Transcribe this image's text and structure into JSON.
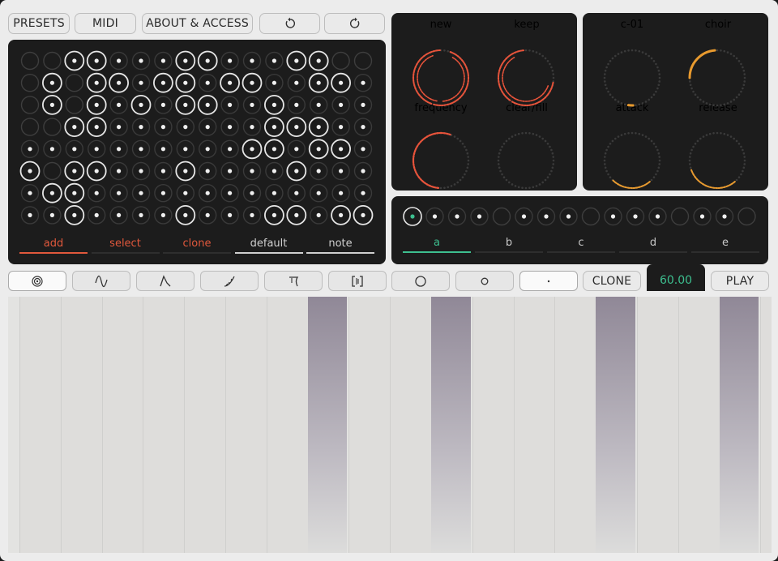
{
  "toolbar": {
    "presets_label": "PRESETS",
    "midi_label": "MIDI",
    "about_label": "ABOUT & ACCESS",
    "undo_icon": "undo-icon",
    "redo_icon": "redo-icon"
  },
  "grid": {
    "rows": [
      "--BB...BB...BB--",
      "-B-BB.BB.BB..BB.",
      "-B-B.B.BB..B....",
      "--BB.......BBB..",
      "..........BB.BB.",
      "B-BB...B....B...",
      ".BB.............",
      "..B....B...BB.BB"
    ],
    "tabs": [
      {
        "label": "add",
        "color": "#e0583c"
      },
      {
        "label": "select",
        "color": "#e0583c"
      },
      {
        "label": "clone",
        "color": "#e0583c"
      },
      {
        "label": "default",
        "color": "#cfcfcf"
      },
      {
        "label": "note",
        "color": "#cfcfcf"
      }
    ]
  },
  "knobs": {
    "new": {
      "label": "new",
      "color": "#e8533a"
    },
    "keep": {
      "label": "keep",
      "color": "#e8533a"
    },
    "frequency": {
      "label": "frequency",
      "color": "#e8533a"
    },
    "clear_fill": {
      "label": "clear/fill",
      "color": "#e8533a"
    },
    "c01": {
      "label": "c-01",
      "color": "#e89a2e"
    },
    "choir": {
      "label": "choir",
      "color": "#e89a2e"
    },
    "attack": {
      "label": "attack",
      "color": "#e89a2e"
    },
    "release": {
      "label": "release",
      "color": "#e89a2e"
    }
  },
  "sequencer": {
    "tabs": [
      "a",
      "b",
      "c",
      "d",
      "e"
    ],
    "active_tab_color": "#3dbf8f"
  },
  "wave_buttons": [
    "spiral-icon",
    "sine-wave-icon",
    "triangle-envelope-icon",
    "ramp-curve-icon",
    "decay-curve-icon",
    "bracket-icon",
    "large-circle-icon",
    "small-circle-icon",
    "dot-icon"
  ],
  "clone_label": "CLONE",
  "tempo": "60.00",
  "play_label": "PLAY",
  "colors": {
    "accent_red": "#e8533a",
    "accent_orange": "#e89a2e",
    "accent_green": "#3dbf8f",
    "key_highlight": "#908897"
  }
}
